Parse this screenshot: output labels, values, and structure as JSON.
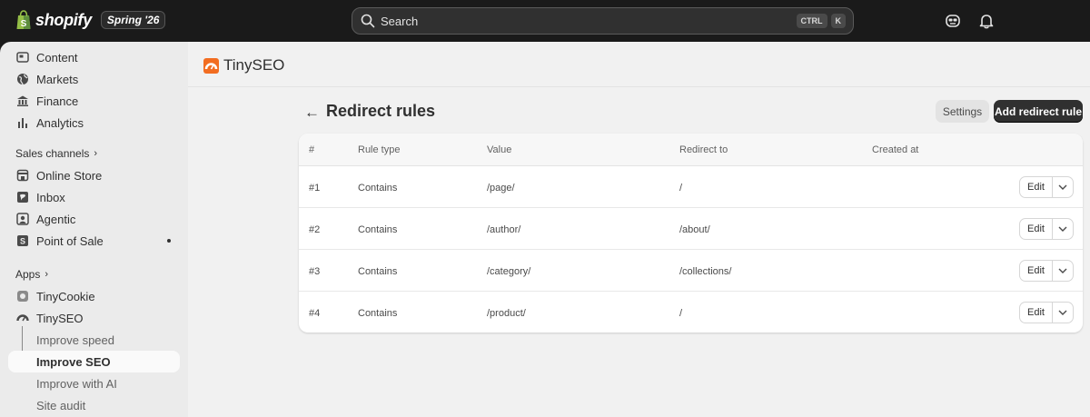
{
  "topbar": {
    "brand": "shopify",
    "edition": "Spring '26",
    "search_placeholder": "Search",
    "shortcut_ctrl": "CTRL",
    "shortcut_key": "K"
  },
  "sidebar": {
    "items_top": [
      {
        "label": "Content",
        "icon": "content-icon"
      },
      {
        "label": "Markets",
        "icon": "globe-icon"
      },
      {
        "label": "Finance",
        "icon": "bank-icon"
      },
      {
        "label": "Analytics",
        "icon": "bar-chart-icon"
      }
    ],
    "sales_channels_title": "Sales channels",
    "sales_channels": [
      {
        "label": "Online Store",
        "icon": "store-icon"
      },
      {
        "label": "Inbox",
        "icon": "inbox-icon"
      },
      {
        "label": "Agentic",
        "icon": "agentic-icon"
      },
      {
        "label": "Point of Sale",
        "icon": "pos-icon"
      }
    ],
    "apps_title": "Apps",
    "apps": [
      {
        "label": "TinyCookie",
        "icon": "cookie-app-icon"
      },
      {
        "label": "TinySEO",
        "icon": "tinyseo-app-icon"
      }
    ],
    "tinyseo_sub": [
      {
        "label": "Improve speed"
      },
      {
        "label": "Improve SEO"
      },
      {
        "label": "Improve with AI"
      },
      {
        "label": "Site audit"
      }
    ]
  },
  "main": {
    "app_name": "TinySEO",
    "page_title": "Redirect rules",
    "settings_label": "Settings",
    "add_label": "Add redirect rule",
    "accent": "#f26d21",
    "table": {
      "headers": [
        "#",
        "Rule type",
        "Value",
        "Redirect to",
        "Created at"
      ],
      "edit_label": "Edit",
      "rows": [
        {
          "num": "#1",
          "type": "Contains",
          "value": "/page/",
          "redirect": "/",
          "created": ""
        },
        {
          "num": "#2",
          "type": "Contains",
          "value": "/author/",
          "redirect": "/about/",
          "created": ""
        },
        {
          "num": "#3",
          "type": "Contains",
          "value": "/category/",
          "redirect": "/collections/",
          "created": ""
        },
        {
          "num": "#4",
          "type": "Contains",
          "value": "/product/",
          "redirect": "/",
          "created": ""
        }
      ]
    }
  }
}
